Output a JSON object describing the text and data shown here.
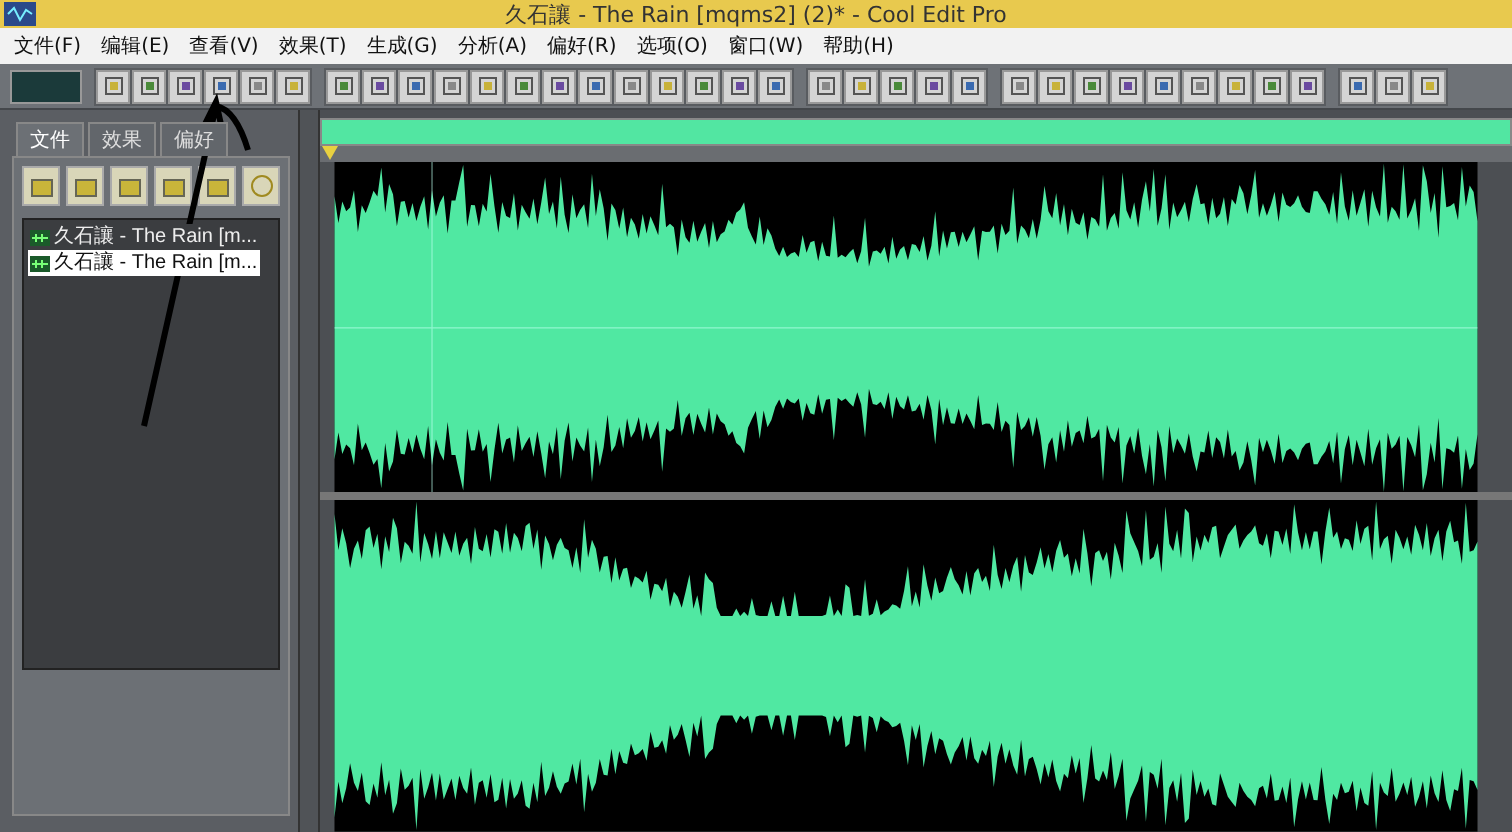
{
  "window": {
    "title": "久石讓 - The Rain [mqms2] (2)* - Cool Edit Pro"
  },
  "menu": [
    "文件(F)",
    "编辑(E)",
    "查看(V)",
    "效果(T)",
    "生成(G)",
    "分析(A)",
    "偏好(R)",
    "选项(O)",
    "窗口(W)",
    "帮助(H)"
  ],
  "sidebar": {
    "tabs": [
      {
        "label": "文件",
        "selected": true
      },
      {
        "label": "效果",
        "selected": false
      },
      {
        "label": "偏好",
        "selected": false
      }
    ],
    "files": [
      {
        "label": "久石讓 - The Rain [m...",
        "selected": false
      },
      {
        "label": "久石讓 - The Rain [m...",
        "selected": true
      }
    ]
  }
}
